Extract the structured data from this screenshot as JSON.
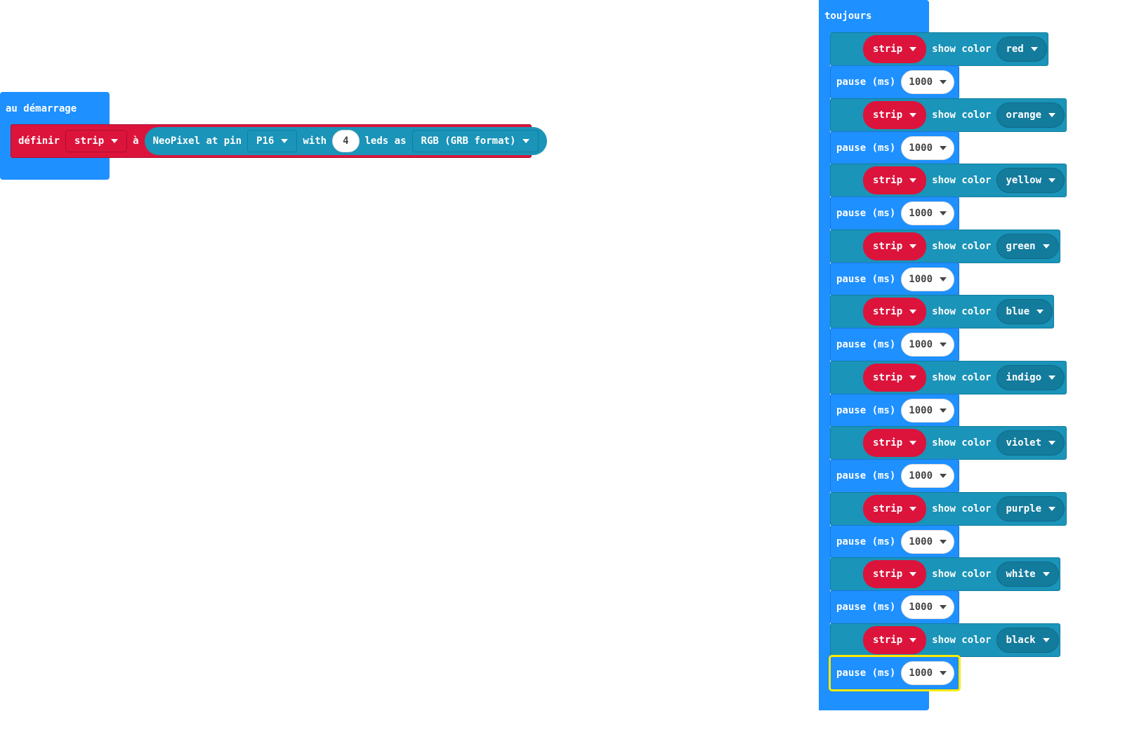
{
  "on_start": {
    "title": "au démarrage",
    "set_block": {
      "keyword": "définir",
      "variable": "strip",
      "to_label": "à",
      "neopixel_label": "NeoPixel at pin",
      "pin": "P16",
      "with_label": "with",
      "leds_count": "4",
      "leds_as_label": "leds as",
      "format": "RGB (GRB format)"
    }
  },
  "forever": {
    "title": "toujours",
    "show_label": "show color",
    "pause_label": "pause (ms)",
    "items": [
      {
        "variable": "strip",
        "color": "red",
        "pause": "1000"
      },
      {
        "variable": "strip",
        "color": "orange",
        "pause": "1000"
      },
      {
        "variable": "strip",
        "color": "yellow",
        "pause": "1000"
      },
      {
        "variable": "strip",
        "color": "green",
        "pause": "1000"
      },
      {
        "variable": "strip",
        "color": "blue",
        "pause": "1000"
      },
      {
        "variable": "strip",
        "color": "indigo",
        "pause": "1000"
      },
      {
        "variable": "strip",
        "color": "violet",
        "pause": "1000"
      },
      {
        "variable": "strip",
        "color": "purple",
        "pause": "1000"
      },
      {
        "variable": "strip",
        "color": "white",
        "pause": "1000"
      },
      {
        "variable": "strip",
        "color": "black",
        "pause": "1000"
      }
    ]
  }
}
